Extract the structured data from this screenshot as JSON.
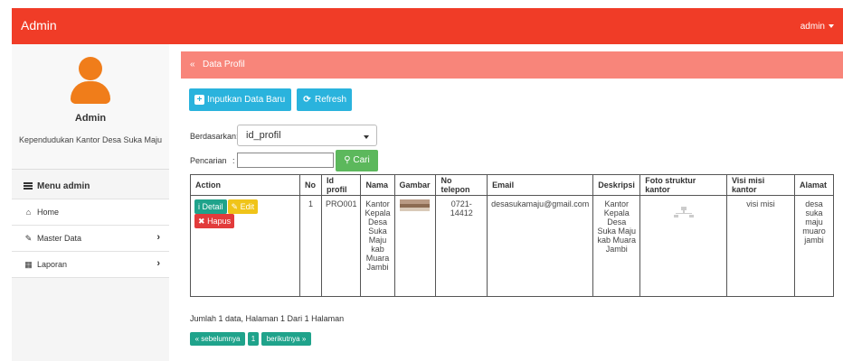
{
  "navbar": {
    "brand": "Admin",
    "user": "admin"
  },
  "sidebar": {
    "profile_name": "Admin",
    "profile_sub": "Kependudukan Kantor Desa Suka Maju",
    "menu_header": "Menu admin",
    "items": [
      {
        "label": "Home",
        "icon": "home-icon"
      },
      {
        "label": "Master Data",
        "icon": "edit-icon"
      },
      {
        "label": "Laporan",
        "icon": "calendar-icon"
      }
    ]
  },
  "panel": {
    "title": "Data Profil"
  },
  "toolbar": {
    "add_label": "Inputkan Data Baru",
    "refresh_label": "Refresh"
  },
  "filter": {
    "by_label": "Berdasarkan:",
    "by_value": "id_profil",
    "search_label": "Pencarian",
    "search_colon": ":",
    "search_value": "",
    "search_button": "Cari"
  },
  "table": {
    "headers": [
      "Action",
      "No",
      "Id profil",
      "Nama",
      "Gambar",
      "No telepon",
      "Email",
      "Deskripsi",
      "Foto struktur kantor",
      "Visi misi kantor",
      "Alamat"
    ],
    "actions": {
      "detail": "Detail",
      "edit": "Edit",
      "hapus": "Hapus"
    },
    "rows": [
      {
        "no": "1",
        "id": "PRO001",
        "nama": "Kantor Kepala Desa Suka Maju kab Muara Jambi",
        "telepon": "0721-14412",
        "email": "desasukamaju@gmail.com",
        "deskripsi": "Kantor Kepala Desa Suka Maju kab Muara Jambi",
        "visi": "visi misi",
        "alamat": "desa suka maju muaro jambi"
      }
    ]
  },
  "footer": {
    "summary": "Jumlah 1 data, Halaman 1 Dari 1 Halaman",
    "prev": "« sebelumnya",
    "page": "1",
    "next": "berikutnya »"
  },
  "colors": {
    "navbar": "#f03c27",
    "panel": "#f8857a",
    "primary": "#2ab3dd",
    "success": "#5cb85c",
    "pager": "#1fa38b"
  }
}
